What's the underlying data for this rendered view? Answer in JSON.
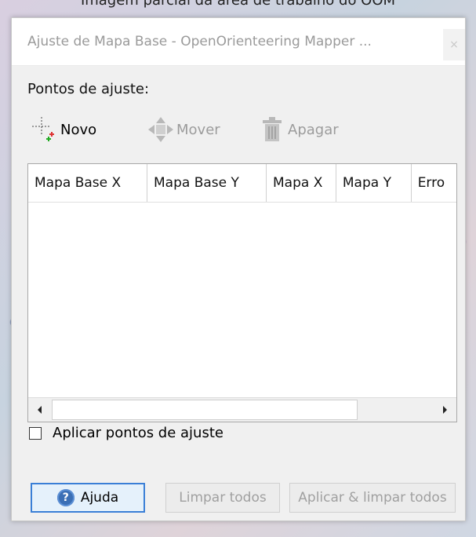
{
  "caption": "Imagem parcial da área de trabalho do OOM",
  "window": {
    "title": "Ajuste de Mapa Base - OpenOrienteering Mapper ...",
    "close_glyph": "×"
  },
  "section_label": "Pontos de ajuste:",
  "toolbar": {
    "new_label": "Novo",
    "move_label": "Mover",
    "delete_label": "Apagar"
  },
  "table": {
    "columns": [
      "Mapa Base X",
      "Mapa Base Y",
      "Mapa X",
      "Mapa Y",
      "Erro"
    ],
    "rows": []
  },
  "apply_checkbox": {
    "label": "Aplicar pontos de ajuste",
    "checked": false
  },
  "buttons": {
    "help_label": "Ajuda",
    "clear_all_label": "Limpar todos",
    "apply_clear_label": "Aplicar & limpar todos"
  },
  "icons": {
    "new": "crosshair-add-icon",
    "move": "move-arrows-icon",
    "delete": "trash-icon",
    "help": "help-icon",
    "scroll_left": "scroll-left-icon",
    "scroll_right": "scroll-right-icon"
  },
  "colors": {
    "accent": "#3a7fd6",
    "disabled_text": "#9c9c9c"
  }
}
